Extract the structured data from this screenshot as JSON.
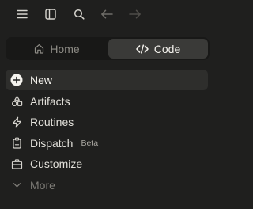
{
  "toolbar": {
    "icons": [
      "hamburger-menu-icon",
      "sidebar-toggle-icon",
      "search-icon",
      "back-arrow-icon",
      "forward-arrow-icon"
    ]
  },
  "mode_switch": {
    "home_label": "Home",
    "code_label": "Code",
    "selected": "Code"
  },
  "menu": {
    "new_label": "New",
    "artifacts_label": "Artifacts",
    "routines_label": "Routines",
    "dispatch_label": "Dispatch",
    "dispatch_badge": "Beta",
    "customize_label": "Customize",
    "more_label": "More"
  },
  "colors": {
    "background": "#1f1f1e",
    "selected_segment": "#3a3a38",
    "text": "#e8e6e1",
    "muted": "#7f7d78"
  }
}
